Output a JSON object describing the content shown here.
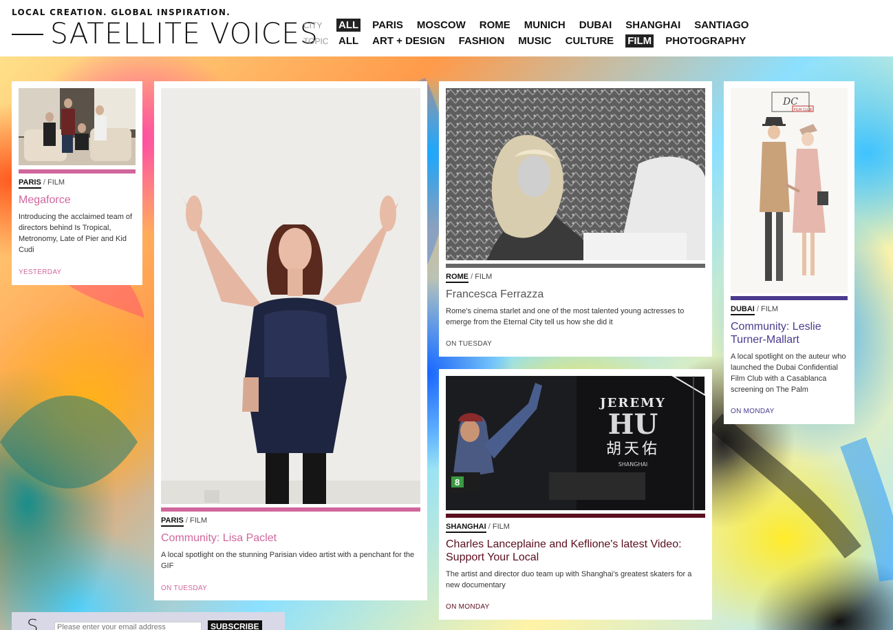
{
  "header": {
    "tagline": "LOCAL CREATION. GLOBAL INSPIRATION.",
    "logo": "SATELLITE VOICES",
    "city": {
      "label": "CITY",
      "items": [
        "ALL",
        "PARIS",
        "MOSCOW",
        "ROME",
        "MUNICH",
        "DUBAI",
        "SHANGHAI",
        "SANTIAGO"
      ],
      "active": "ALL"
    },
    "topic": {
      "label": "TOPIC",
      "items": [
        "ALL",
        "ART + DESIGN",
        "FASHION",
        "MUSIC",
        "CULTURE",
        "FILM",
        "PHOTOGRAPHY"
      ],
      "active": "FILM"
    }
  },
  "cards": [
    {
      "city": "PARIS",
      "topic": "FILM",
      "title": "Megaforce",
      "description": "Introducing the acclaimed team of directors behind Is Tropical, Metronomy, Late of Pier and Kid Cudi",
      "date": "YESTERDAY",
      "color": "#d0669c"
    },
    {
      "city": "PARIS",
      "topic": "FILM",
      "title": "Community: Lisa Paclet",
      "description": "A local spotlight on the stunning Parisian video artist with a penchant for the GIF",
      "date": "ON TUESDAY",
      "color": "#d0669c"
    },
    {
      "city": "ROME",
      "topic": "FILM",
      "title": "Francesca Ferrazza",
      "description": "Rome's cinema starlet and one of the most talented young actresses to emerge from the Eternal City tell us how she did it",
      "date": "ON TUESDAY",
      "color": "#666666"
    },
    {
      "city": "SHANGHAI",
      "topic": "FILM",
      "title": "Charles Lanceplaine and Keflione's latest Video: Support Your Local",
      "description": "The artist and director duo team up with Shanghai's greatest skaters for a new documentary",
      "date": "ON MONDAY",
      "color": "#5a0e1e",
      "thumb_text": {
        "line1": "JEREMY",
        "line2": "HU",
        "chinese": "胡天佑",
        "sub": "SHANGHAI",
        "badge": "8"
      }
    },
    {
      "city": "DUBAI",
      "topic": "FILM",
      "title": "Community: Leslie Turner-Mallart",
      "description": "A local spotlight on the auteur who launched the Dubai Confidential Film Club with a Casablanca screening on The Palm",
      "date": "ON MONDAY",
      "color": "#4a3a8c",
      "thumb_text": {
        "logo": "DC",
        "logo_sub": "FILM CLUB"
      }
    }
  ],
  "subscribe": {
    "icon_letter": "S",
    "placeholder": "Please enter your email address",
    "button": "SUBSCRIBE"
  }
}
